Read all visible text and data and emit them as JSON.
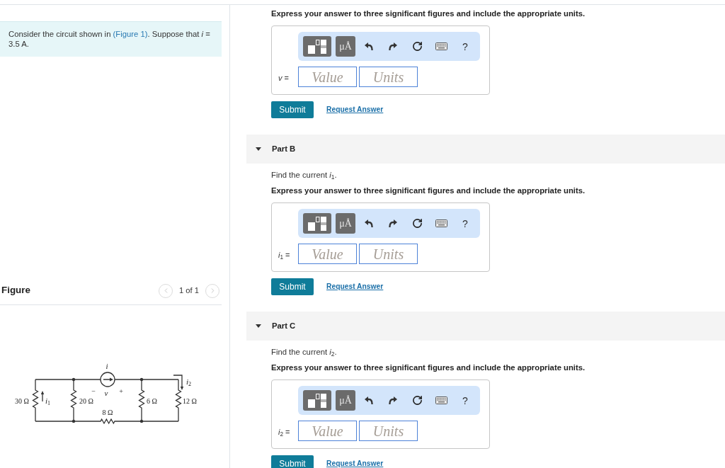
{
  "problem": {
    "before": "Consider the circuit shown in ",
    "link": "(Figure 1)",
    "after": ". Suppose that *i* = 3.5 A."
  },
  "figure": {
    "title": "Figure",
    "prev": {
      "disabled": true
    },
    "pager": "1 of 1",
    "next": {
      "disabled": true
    },
    "circuit": {
      "source": {
        "current": "i",
        "minus": "−",
        "voltage": "v",
        "plus": "+"
      },
      "resistors": [
        "30 Ω",
        "20 Ω",
        "8 Ω",
        "6 Ω",
        "12 Ω"
      ],
      "currents": [
        {
          "symbol": "i",
          "subscript": "1"
        },
        {
          "symbol": "i",
          "subscript": "2"
        }
      ]
    }
  },
  "parts": [
    {
      "instruction": "Express your answer to three significant figures and include the appropriate units.",
      "toolbar": [
        {
          "kind": "templates"
        },
        {
          "kind": "units",
          "label": "μÅ"
        },
        {
          "kind": "undo"
        },
        {
          "kind": "redo"
        },
        {
          "kind": "reset"
        },
        {
          "kind": "keyboard"
        },
        {
          "kind": "help",
          "label": "?"
        }
      ],
      "variable": "*v* =",
      "value_field": {
        "placeholder": "Value"
      },
      "units_field": {
        "placeholder": "Units"
      },
      "submit": "Submit",
      "request_answer": "Request Answer"
    },
    {
      "title": "Part B",
      "expanded": true,
      "prompt": "Find the current *i*$_{1}$.",
      "instruction": "Express your answer to three significant figures and include the appropriate units.",
      "toolbar": [
        {
          "kind": "templates"
        },
        {
          "kind": "units",
          "label": "μÅ"
        },
        {
          "kind": "undo"
        },
        {
          "kind": "redo"
        },
        {
          "kind": "reset"
        },
        {
          "kind": "keyboard"
        },
        {
          "kind": "help",
          "label": "?"
        }
      ],
      "variable": "*i*$_{1}$ =",
      "value_field": {
        "placeholder": "Value"
      },
      "units_field": {
        "placeholder": "Units"
      },
      "submit": "Submit",
      "request_answer": "Request Answer"
    },
    {
      "title": "Part C",
      "expanded": true,
      "prompt": "Find the current *i*$_{2}$.",
      "instruction": "Express your answer to three significant figures and include the appropriate units.",
      "toolbar": [
        {
          "kind": "templates"
        },
        {
          "kind": "units",
          "label": "μÅ"
        },
        {
          "kind": "undo"
        },
        {
          "kind": "redo"
        },
        {
          "kind": "reset"
        },
        {
          "kind": "keyboard"
        },
        {
          "kind": "help",
          "label": "?"
        }
      ],
      "variable": "*i*$_{2}$ =",
      "value_field": {
        "placeholder": "Value"
      },
      "units_field": {
        "placeholder": "Units"
      },
      "submit": "Submit",
      "request_answer": "Request Answer"
    }
  ]
}
